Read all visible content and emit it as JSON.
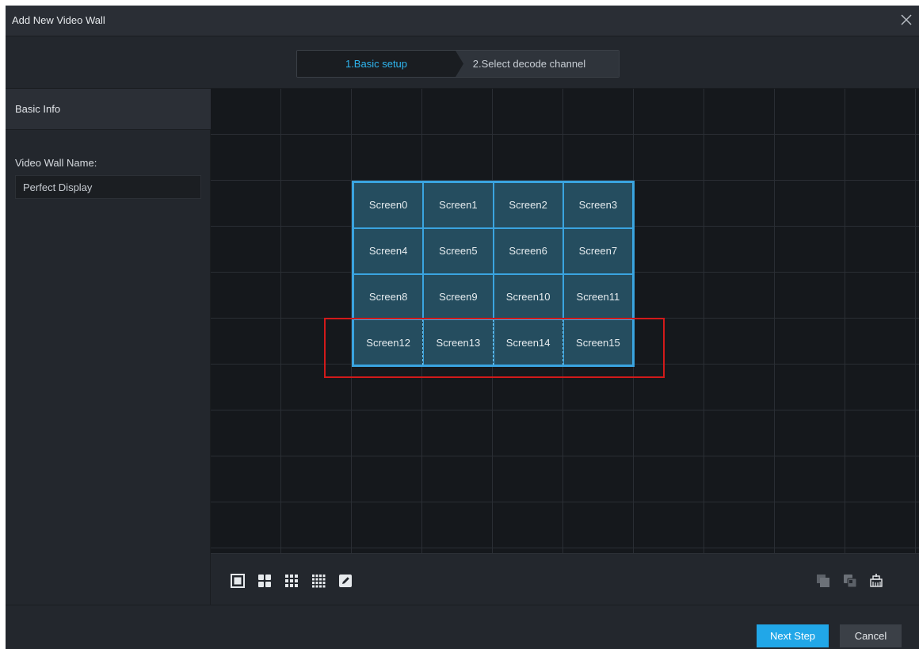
{
  "window": {
    "title": "Add New Video Wall"
  },
  "steps": [
    {
      "label": "1.Basic setup",
      "active": true
    },
    {
      "label": "2.Select decode channel",
      "active": false
    }
  ],
  "sidebar": {
    "section_title": "Basic Info",
    "name_label": "Video Wall Name:",
    "name_value": "Perfect Display"
  },
  "wall": {
    "rows": 4,
    "cols": 4,
    "screens": [
      "Screen0",
      "Screen1",
      "Screen2",
      "Screen3",
      "Screen4",
      "Screen5",
      "Screen6",
      "Screen7",
      "Screen8",
      "Screen9",
      "Screen10",
      "Screen11",
      "Screen12",
      "Screen13",
      "Screen14",
      "Screen15"
    ],
    "highlighted_row": 3
  },
  "toolbar": {
    "left_icons": [
      "layout-1x1-icon",
      "layout-2x2-icon",
      "layout-3x3-icon",
      "layout-4x4-icon",
      "custom-layout-edit-icon"
    ],
    "right_icons": [
      "split-screen-icon",
      "merge-screen-icon",
      "clear-screen-icon"
    ]
  },
  "footer": {
    "next_label": "Next Step",
    "cancel_label": "Cancel"
  },
  "colors": {
    "accent": "#21a7e8",
    "screen_border": "#3aa4e0",
    "screen_fill": "#254d5f",
    "highlight_red": "#d11a1a",
    "background": "#23272d"
  }
}
